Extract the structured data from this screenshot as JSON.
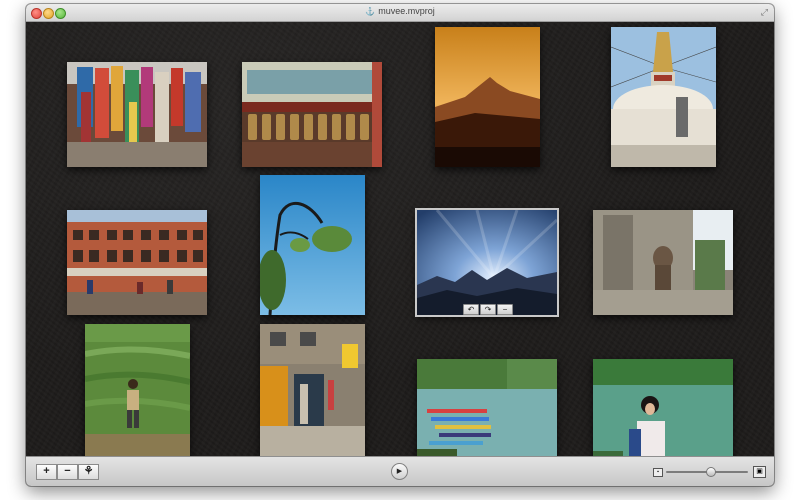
{
  "window": {
    "title": "muvee.mvproj",
    "title_icon": "document-icon"
  },
  "photos": [
    {
      "id": "photo-1",
      "subject": "market-stalls-fabrics"
    },
    {
      "id": "photo-2",
      "subject": "prayer-wheels"
    },
    {
      "id": "photo-3",
      "subject": "mountain-sunset"
    },
    {
      "id": "photo-4",
      "subject": "stupa"
    },
    {
      "id": "photo-5",
      "subject": "street-buildings"
    },
    {
      "id": "photo-6",
      "subject": "tree-branch-sky"
    },
    {
      "id": "photo-7",
      "subject": "mountain-sun-rays"
    },
    {
      "id": "photo-8",
      "subject": "monkey-temple"
    },
    {
      "id": "photo-9",
      "subject": "hiker-terraces"
    },
    {
      "id": "photo-10",
      "subject": "street-shops"
    },
    {
      "id": "photo-11",
      "subject": "boats-lake"
    },
    {
      "id": "photo-12",
      "subject": "woman-by-lake"
    }
  ],
  "selected_photo_controls": {
    "rotate_left_glyph": "↶",
    "rotate_right_glyph": "↷",
    "remove_glyph": "−"
  },
  "toolbar": {
    "add_glyph": "+",
    "remove_glyph": "−",
    "effects_glyph": "⚘",
    "play_glyph": "▶",
    "zoom_small_glyph": "▪",
    "zoom_large_glyph": "▣",
    "zoom_level": 0.55
  },
  "colors": {
    "canvas_bg": "#1e1c1b",
    "toolbar_bg": "#d6d6d6",
    "titlebar_bg": "#e0e0e0"
  }
}
